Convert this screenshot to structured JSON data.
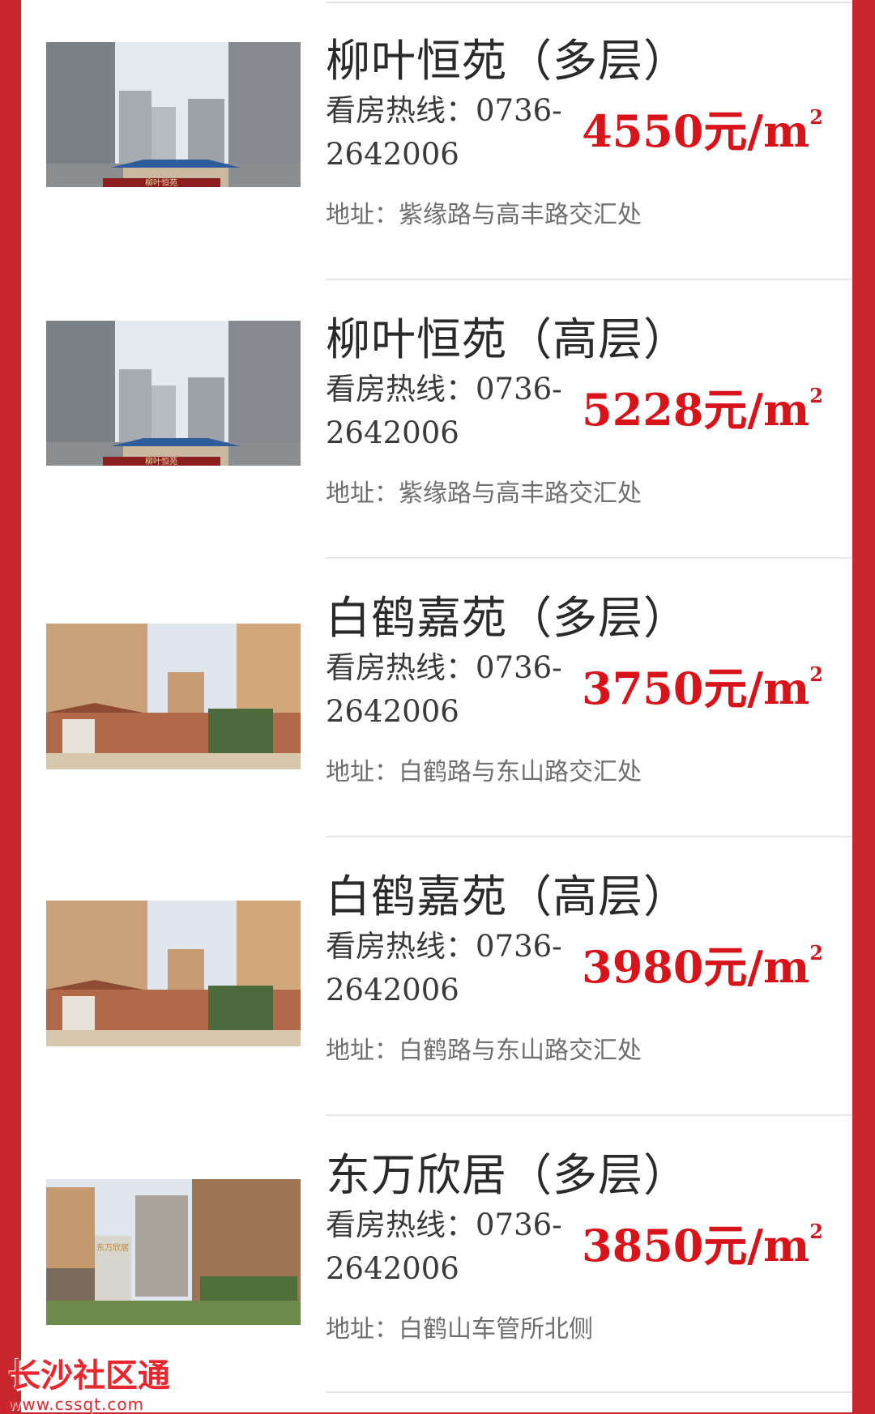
{
  "listings": [
    {
      "title": "柳叶恒苑（多层）",
      "hotline_label": "看房热线：",
      "hotline_number": "0736-2642006",
      "price": "4550元/m",
      "price_unit_power": "2",
      "address": "地址：紫缘路与高丰路交汇处",
      "photo_sign": "柳叶恒苑"
    },
    {
      "title": "柳叶恒苑（高层）",
      "hotline_label": "看房热线：",
      "hotline_number": "0736-2642006",
      "price": "5228元/m",
      "price_unit_power": "2",
      "address": "地址：紫缘路与高丰路交汇处",
      "photo_sign": "柳叶恒苑"
    },
    {
      "title": "白鹤嘉苑（多层）",
      "hotline_label": "看房热线：",
      "hotline_number": "0736-2642006",
      "price": "3750元/m",
      "price_unit_power": "2",
      "address": "地址：白鹤路与东山路交汇处"
    },
    {
      "title": "白鹤嘉苑（高层）",
      "hotline_label": "看房热线：",
      "hotline_number": "0736-2642006",
      "price": "3980元/m",
      "price_unit_power": "2",
      "address": "地址：白鹤路与东山路交汇处"
    },
    {
      "title": "东万欣居（多层）",
      "hotline_label": "看房热线：",
      "hotline_number": "0736-2642006",
      "price": "3850元/m",
      "price_unit_power": "2",
      "address": "地址：白鹤山车管所北侧",
      "photo_sign": "东万欣居"
    }
  ],
  "watermark": {
    "title": "长沙社区通",
    "url": "www.cssqt.com"
  },
  "colors": {
    "frame": "#c8262c",
    "price": "#d8141a",
    "background": "#ffffff"
  }
}
